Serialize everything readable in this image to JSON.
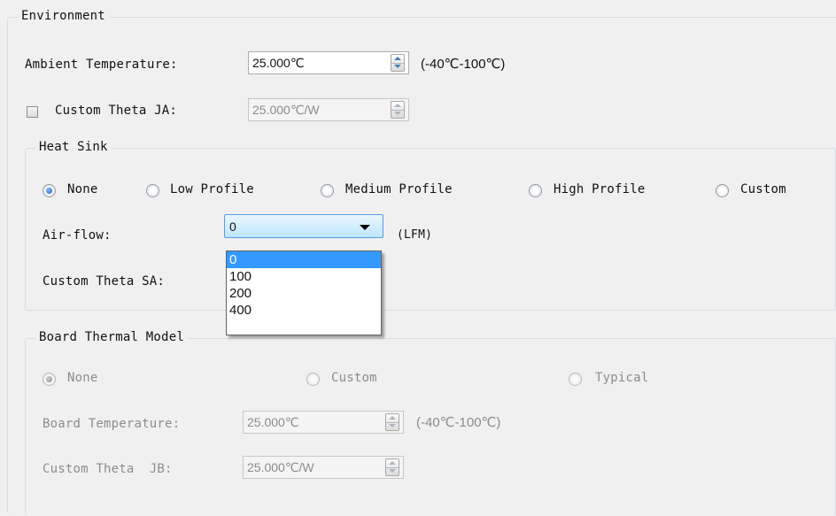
{
  "environment": {
    "title": "Environment",
    "ambient_label": "Ambient Temperature:",
    "ambient_value": "25.000℃",
    "ambient_range": "(-40℃-100℃)",
    "custom_theta_ja_label": "Custom Theta JA:",
    "custom_theta_ja_checked": false,
    "custom_theta_ja_value": "25.000℃/W"
  },
  "heat_sink": {
    "title": "Heat Sink",
    "options": [
      "None",
      "Low Profile",
      "Medium Profile",
      "High Profile",
      "Custom"
    ],
    "selected": "None",
    "airflow_label": "Air-flow:",
    "airflow_value": "0",
    "airflow_unit": "(LFM)",
    "airflow_options": [
      "0",
      "100",
      "200",
      "400"
    ],
    "custom_theta_sa_label": "Custom Theta SA:"
  },
  "board_thermal_model": {
    "title": "Board Thermal Model",
    "options": [
      "None",
      "Custom",
      "Typical"
    ],
    "selected": "None",
    "board_temp_label": "Board Temperature:",
    "board_temp_value": "25.000℃",
    "board_temp_range": "(-40℃-100℃)",
    "custom_theta_jb_label": "Custom Theta  JB:",
    "custom_theta_jb_value": "25.000℃/W"
  },
  "colors": {
    "accent": "#3399ff",
    "disabled_text": "#8c8c8c",
    "group_border": "#d5dfe5"
  }
}
